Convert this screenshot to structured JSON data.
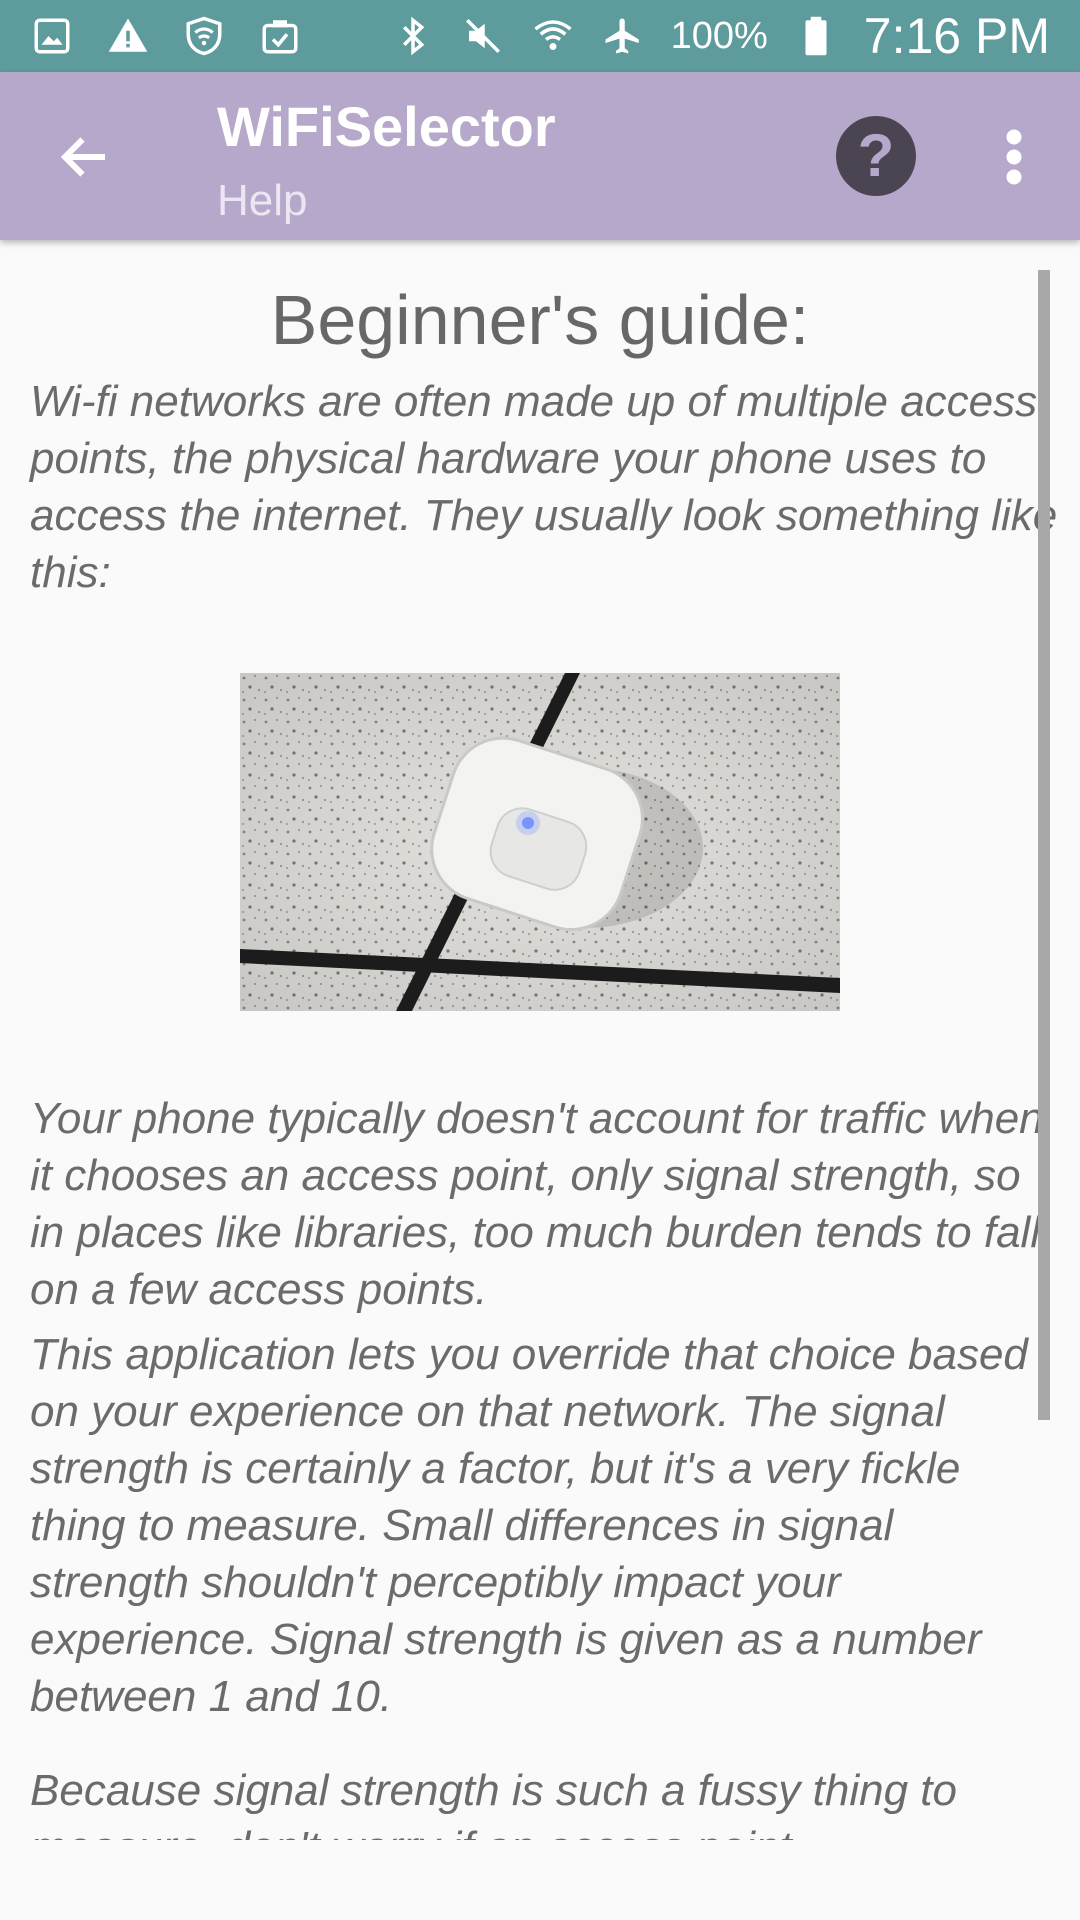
{
  "status_bar": {
    "left_icons": [
      "gallery-icon",
      "warning-icon",
      "shield-wifi-icon",
      "clipboard-check-icon"
    ],
    "right_icons": [
      "bluetooth-icon",
      "mute-icon",
      "wifi-signal-icon",
      "airplane-icon",
      "battery-icon"
    ],
    "battery": "100%",
    "time": "7:16 PM"
  },
  "app_bar": {
    "title": "WiFiSelector",
    "subtitle": "Help",
    "help_label": "?",
    "colors": {
      "app_bar": "#b6a8cb",
      "status_bar": "#5e9b9d"
    }
  },
  "content": {
    "heading": "Beginner's guide:",
    "paragraph_1": "Wi-fi networks are often made up of multiple access points, the physical hardware your phone uses to access the internet. They usually look something like this:",
    "paragraph_2": "Your phone typically doesn't account for traffic when it chooses an access point, only signal strength, so in places like libraries, too much burden tends to fall on a few access points.",
    "paragraph_3": "This application lets you override that choice based on your experience on that network. The signal strength is certainly a factor, but it's a very fickle thing to measure. Small differences in signal strength shouldn't perceptibly impact your experience. Signal strength is given as a number between 1 and 10.",
    "paragraph_4": "Because signal strength is such a fussy thing to measure, don't worry if an access point"
  }
}
